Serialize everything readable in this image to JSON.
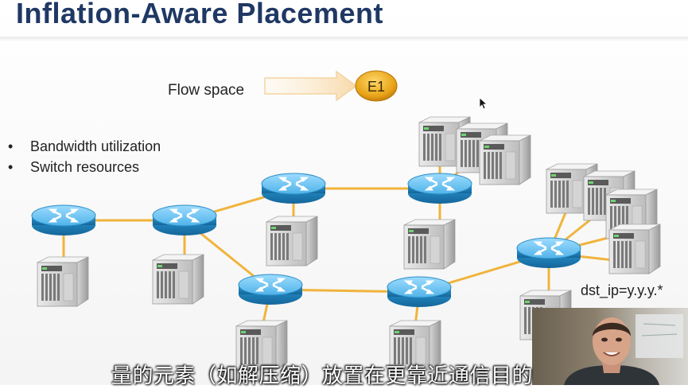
{
  "slide": {
    "title": "Inflation-Aware Placement",
    "flow_space_label": "Flow space",
    "badge_label": "E1",
    "bullets": [
      "Bandwidth utilization",
      "Switch resources"
    ],
    "rule_label": "dst_ip=y.y.y.*"
  },
  "subtitle": "量的元素（如解压缩）放置在更靠近通信目的",
  "colors": {
    "title": "#1f3864",
    "link": "#f0b43c",
    "router_top": "#6ec3f0",
    "router_side": "#1f8fc8",
    "badge": "#e8a317"
  },
  "icons": [
    "router-icon",
    "server-icon",
    "arrow-icon",
    "cursor-icon"
  ]
}
